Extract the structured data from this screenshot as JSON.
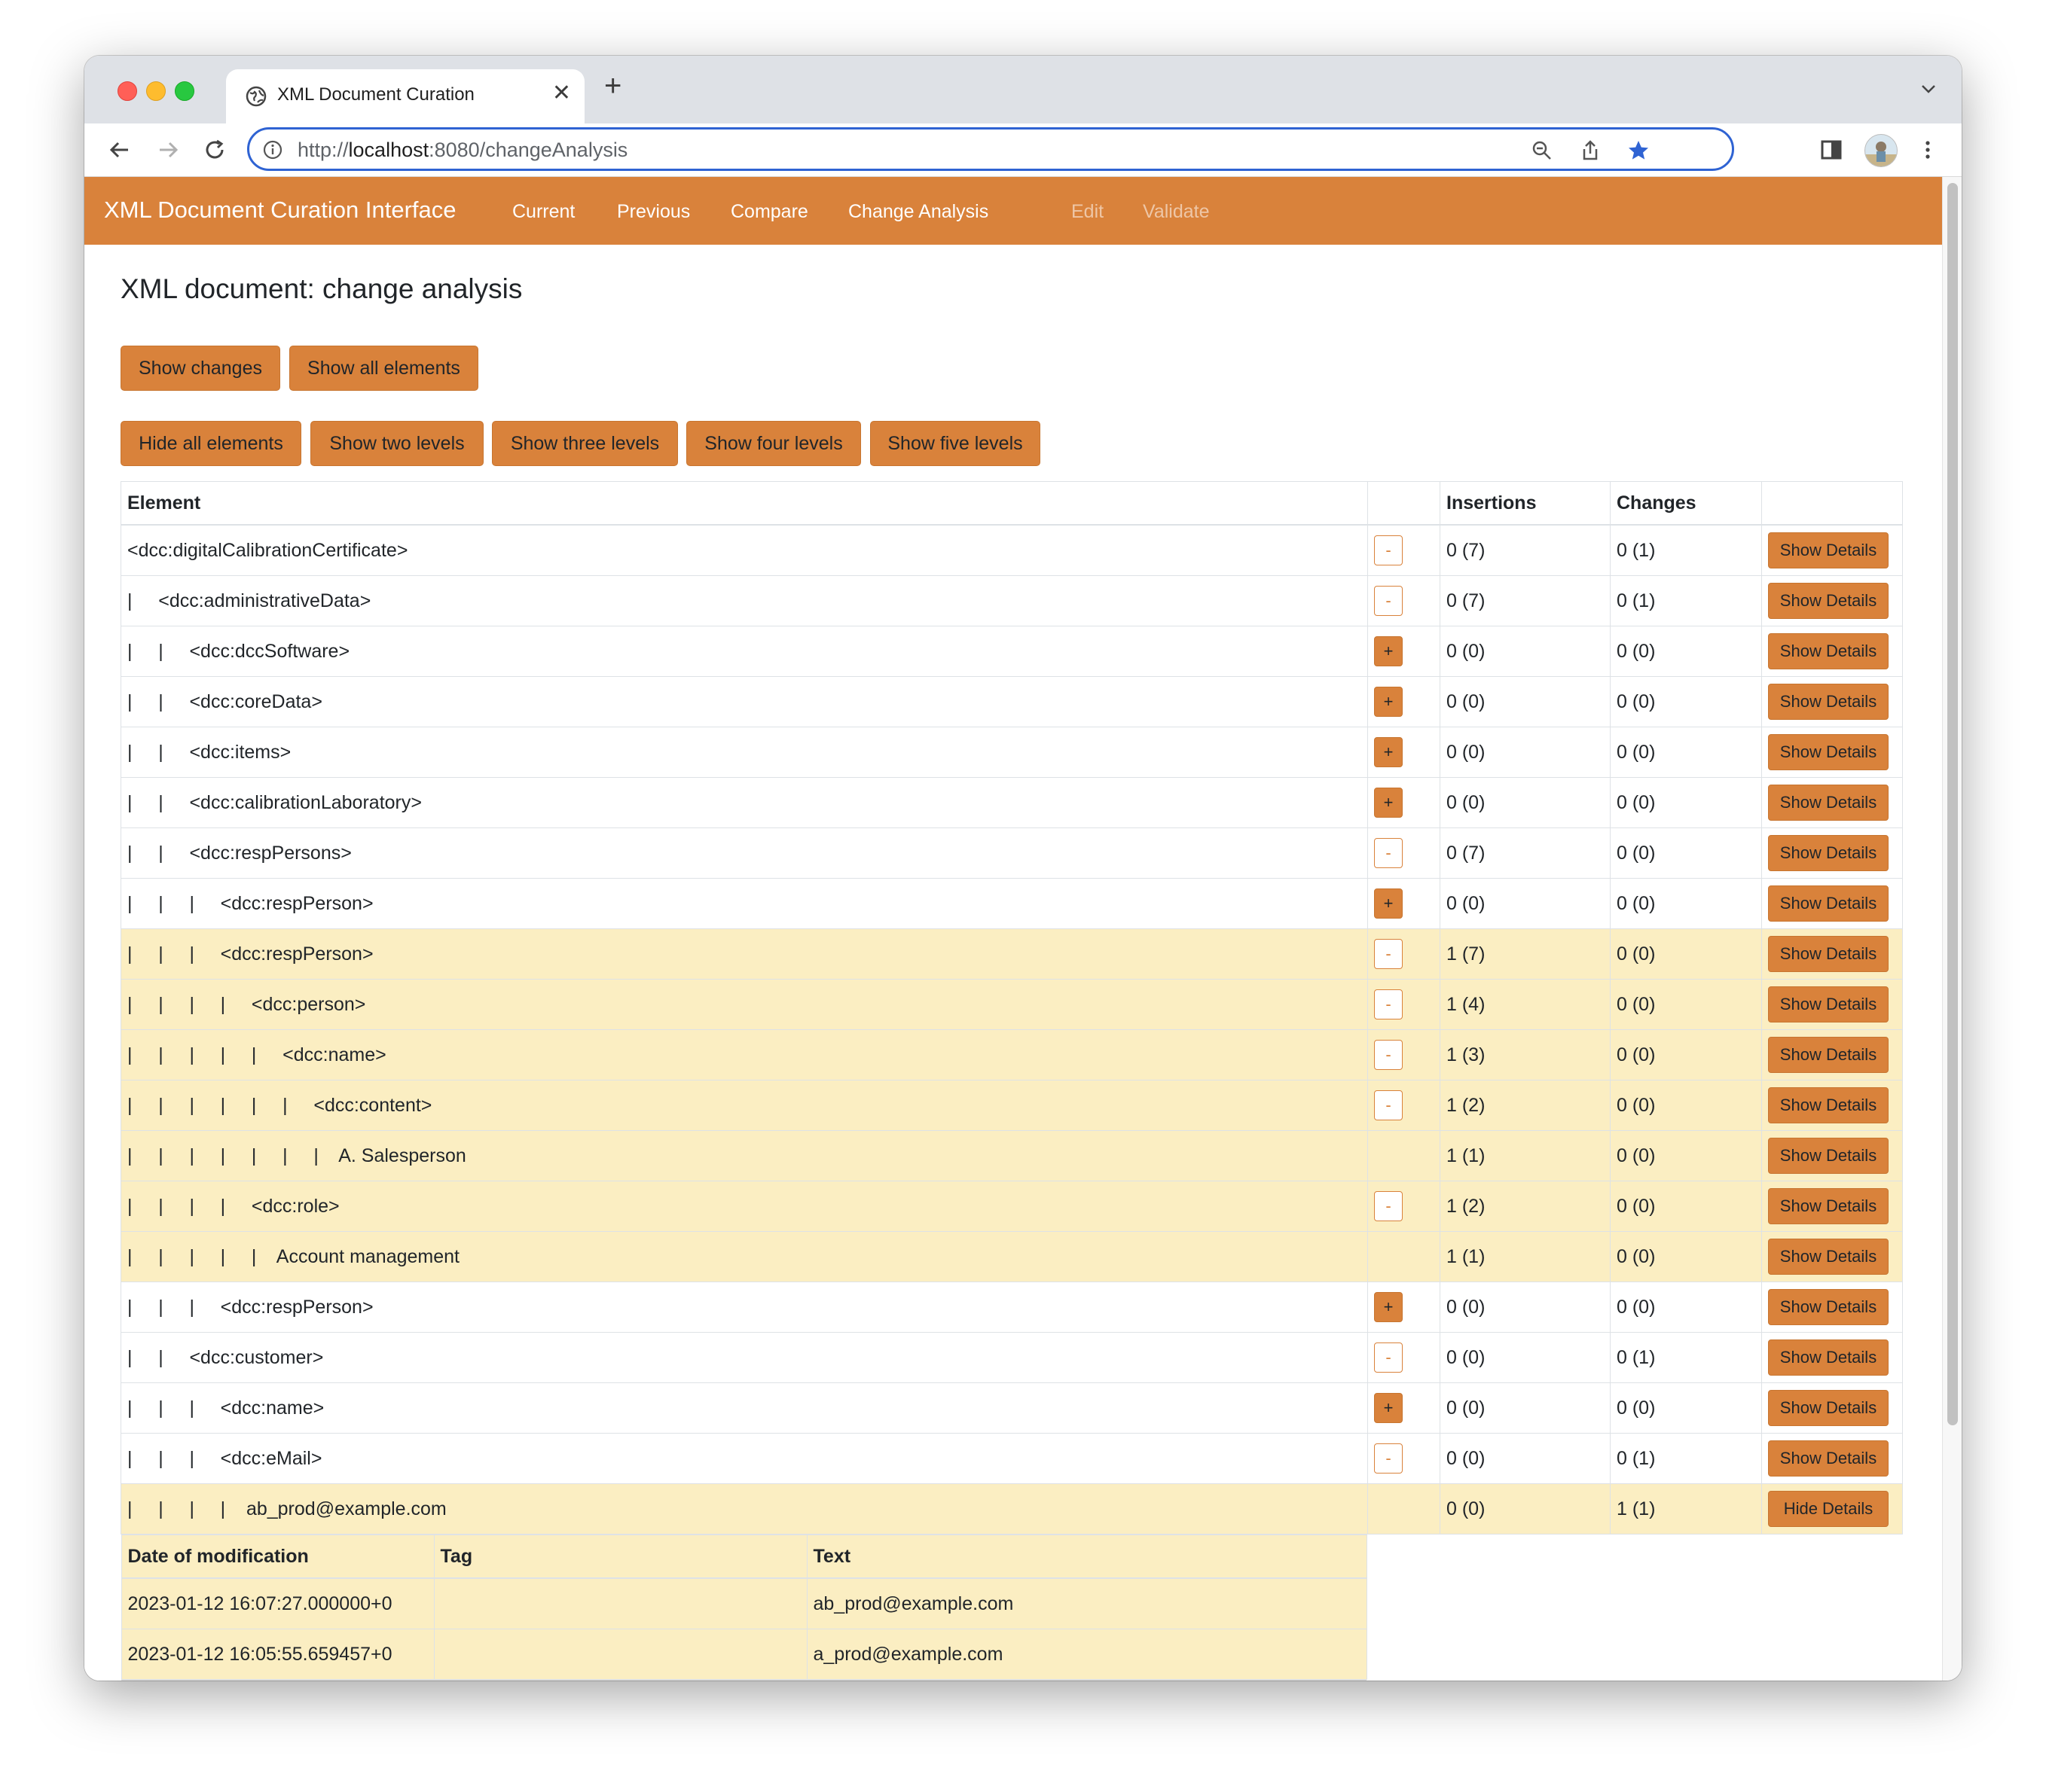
{
  "browser": {
    "tab_title": "XML Document Curation",
    "url_prefix": "http://",
    "url_host": "localhost",
    "url_path": ":8080/changeAnalysis"
  },
  "navbar": {
    "brand": "XML Document Curation Interface",
    "links": [
      "Current",
      "Previous",
      "Compare",
      "Change Analysis",
      "Edit",
      "Validate"
    ]
  },
  "page": {
    "title": "XML document: change analysis",
    "buttons_row1": [
      "Show changes",
      "Show all elements"
    ],
    "buttons_row2": [
      "Hide all elements",
      "Show two levels",
      "Show three levels",
      "Show four levels",
      "Show five levels"
    ]
  },
  "table": {
    "headers": [
      "Element",
      "",
      "Insertions",
      "Changes",
      ""
    ],
    "rows": [
      {
        "element": "<dcc:digitalCalibrationCertificate>",
        "toggle": "-",
        "ins": "0 (7)",
        "chg": "0 (1)",
        "action": "Show Details",
        "hl": false
      },
      {
        "element": "|     <dcc:administrativeData>",
        "toggle": "-",
        "ins": "0 (7)",
        "chg": "0 (1)",
        "action": "Show Details",
        "hl": false
      },
      {
        "element": "|     |     <dcc:dccSoftware>",
        "toggle": "+",
        "ins": "0 (0)",
        "chg": "0 (0)",
        "action": "Show Details",
        "hl": false
      },
      {
        "element": "|     |     <dcc:coreData>",
        "toggle": "+",
        "ins": "0 (0)",
        "chg": "0 (0)",
        "action": "Show Details",
        "hl": false
      },
      {
        "element": "|     |     <dcc:items>",
        "toggle": "+",
        "ins": "0 (0)",
        "chg": "0 (0)",
        "action": "Show Details",
        "hl": false
      },
      {
        "element": "|     |     <dcc:calibrationLaboratory>",
        "toggle": "+",
        "ins": "0 (0)",
        "chg": "0 (0)",
        "action": "Show Details",
        "hl": false
      },
      {
        "element": "|     |     <dcc:respPersons>",
        "toggle": "-",
        "ins": "0 (7)",
        "chg": "0 (0)",
        "action": "Show Details",
        "hl": false
      },
      {
        "element": "|     |     |     <dcc:respPerson>",
        "toggle": "+",
        "ins": "0 (0)",
        "chg": "0 (0)",
        "action": "Show Details",
        "hl": false
      },
      {
        "element": "|     |     |     <dcc:respPerson>",
        "toggle": "-",
        "ins": "1 (7)",
        "chg": "0 (0)",
        "action": "Show Details",
        "hl": true
      },
      {
        "element": "|     |     |     |     <dcc:person>",
        "toggle": "-",
        "ins": "1 (4)",
        "chg": "0 (0)",
        "action": "Show Details",
        "hl": true
      },
      {
        "element": "|     |     |     |     |     <dcc:name>",
        "toggle": "-",
        "ins": "1 (3)",
        "chg": "0 (0)",
        "action": "Show Details",
        "hl": true
      },
      {
        "element": "|     |     |     |     |     |     <dcc:content>",
        "toggle": "-",
        "ins": "1 (2)",
        "chg": "0 (0)",
        "action": "Show Details",
        "hl": true
      },
      {
        "element": "|     |     |     |     |     |     |    A. Salesperson",
        "toggle": "",
        "ins": "1 (1)",
        "chg": "0 (0)",
        "action": "Show Details",
        "hl": true
      },
      {
        "element": "|     |     |     |     <dcc:role>",
        "toggle": "-",
        "ins": "1 (2)",
        "chg": "0 (0)",
        "action": "Show Details",
        "hl": true
      },
      {
        "element": "|     |     |     |     |    Account management",
        "toggle": "",
        "ins": "1 (1)",
        "chg": "0 (0)",
        "action": "Show Details",
        "hl": true
      },
      {
        "element": "|     |     |     <dcc:respPerson>",
        "toggle": "+",
        "ins": "0 (0)",
        "chg": "0 (0)",
        "action": "Show Details",
        "hl": false
      },
      {
        "element": "|     |     <dcc:customer>",
        "toggle": "-",
        "ins": "0 (0)",
        "chg": "0 (1)",
        "action": "Show Details",
        "hl": false
      },
      {
        "element": "|     |     |     <dcc:name>",
        "toggle": "+",
        "ins": "0 (0)",
        "chg": "0 (0)",
        "action": "Show Details",
        "hl": false
      },
      {
        "element": "|     |     |     <dcc:eMail>",
        "toggle": "-",
        "ins": "0 (0)",
        "chg": "0 (1)",
        "action": "Show Details",
        "hl": false
      },
      {
        "element": "|     |     |     |    ab_prod@example.com",
        "toggle": "",
        "ins": "0 (0)",
        "chg": "1 (1)",
        "action": "Hide Details",
        "hl": true
      }
    ]
  },
  "details": {
    "headers": [
      "Date of modification",
      "Tag",
      "Text"
    ],
    "rows": [
      [
        "2023-01-12 16:07:27.000000+0",
        "",
        "ab_prod@example.com"
      ],
      [
        "2023-01-12 16:05:55.659457+0",
        "",
        "a_prod@example.com"
      ]
    ]
  }
}
